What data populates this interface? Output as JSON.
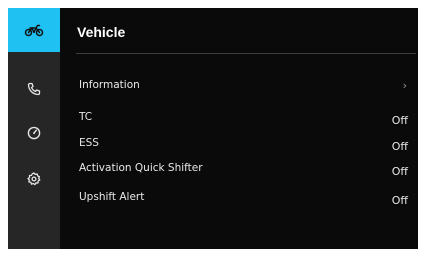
{
  "sidebar": {
    "items": [
      {
        "icon": "motorcycle-icon",
        "active": true
      },
      {
        "icon": "phone-icon",
        "active": false
      },
      {
        "icon": "gauge-icon",
        "active": false
      },
      {
        "icon": "settings-gear-icon",
        "active": false
      }
    ]
  },
  "header": {
    "title": "Vehicle"
  },
  "menu": {
    "information": {
      "label": "Information",
      "chevron": "›"
    },
    "tc": {
      "label": "TC",
      "value": "Off"
    },
    "ess": {
      "label": "ESS",
      "value": "Off"
    },
    "quick_shifter": {
      "label": "Activation Quick Shifter",
      "value": "Off"
    },
    "upshift_alert": {
      "label": "Upshift Alert",
      "value": "Off"
    }
  },
  "colors": {
    "accent": "#1ec1f2",
    "background": "#0a0a0a",
    "sidebar": "#262626",
    "text": "#e8e8e8"
  }
}
